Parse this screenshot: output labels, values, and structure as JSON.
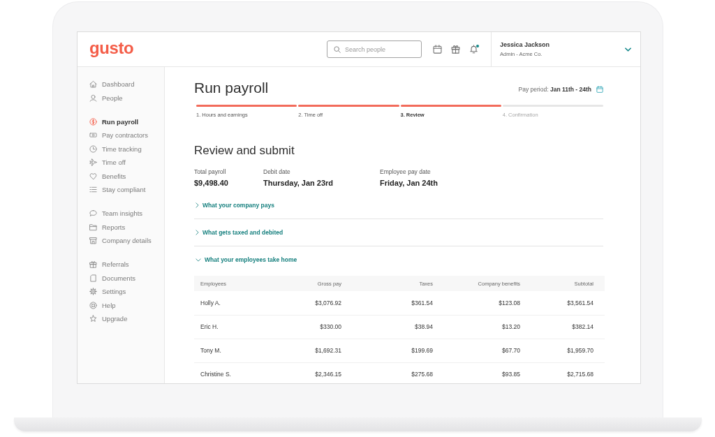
{
  "header": {
    "logo": "gusto",
    "search": {
      "placeholder": "Search people"
    },
    "notifications_unread": true,
    "user": {
      "name": "Jessica Jackson",
      "role": "Admin - Acme Co."
    }
  },
  "sidebar": {
    "groups": [
      {
        "items": [
          {
            "label": "Dashboard",
            "selected": false
          },
          {
            "label": "People",
            "selected": false
          }
        ]
      },
      {
        "items": [
          {
            "label": "Run payroll",
            "selected": true
          },
          {
            "label": "Pay contractors",
            "selected": false
          },
          {
            "label": "Time tracking",
            "selected": false
          },
          {
            "label": "Time off",
            "selected": false
          },
          {
            "label": "Benefits",
            "selected": false
          },
          {
            "label": "Stay compliant",
            "selected": false
          }
        ]
      },
      {
        "items": [
          {
            "label": "Team insights",
            "selected": false
          },
          {
            "label": "Reports",
            "selected": false
          },
          {
            "label": "Company details",
            "selected": false
          }
        ]
      },
      {
        "items": [
          {
            "label": "Referrals",
            "selected": false
          },
          {
            "label": "Documents",
            "selected": false
          },
          {
            "label": "Settings",
            "selected": false
          },
          {
            "label": "Help",
            "selected": false
          },
          {
            "label": "Upgrade",
            "selected": false
          }
        ]
      }
    ]
  },
  "page": {
    "title": "Run payroll",
    "pay_period": "Pay period: **Jan 11th - 24th**"
  },
  "steps": [
    {
      "label": "1. Hours and earnings",
      "reached": true,
      "selected": false
    },
    {
      "label": "2. Time off",
      "reached": true,
      "selected": false
    },
    {
      "label": "3. Review",
      "reached": true,
      "selected": true
    },
    {
      "label": "4. Confirmation",
      "reached": false,
      "selected": false
    }
  ],
  "review": {
    "heading": "Review and submit",
    "summary": [
      {
        "label": "Total payroll",
        "value": "$9,498.40"
      },
      {
        "label": "Debit date",
        "value": "Thursday, Jan 23rd"
      },
      {
        "label": "Employee pay date",
        "value": "Friday, Jan 24th"
      }
    ],
    "sections": [
      {
        "title": "What your company pays",
        "expanded": false
      },
      {
        "title": "What gets taxed and debited",
        "expanded": false
      },
      {
        "title": "What your employees take home",
        "expanded": true,
        "table": {
          "columns": [
            "Employees",
            "Gross pay",
            "Taxes",
            "Company benefits",
            "Subtotal"
          ],
          "rows": [
            [
              "Holly A.",
              "$3,076.92",
              "$361.54",
              "$123.08",
              "$3,561.54"
            ],
            [
              "Eric H.",
              "$330.00",
              "$38.94",
              "$13.20",
              "$382.14"
            ],
            [
              "Tony M.",
              "$1,692.31",
              "$199.69",
              "$67.70",
              "$1,959.70"
            ],
            [
              "Christine S.",
              "$2,346.15",
              "$275.68",
              "$93.85",
              "$2,715.68"
            ]
          ]
        }
      }
    ]
  }
}
